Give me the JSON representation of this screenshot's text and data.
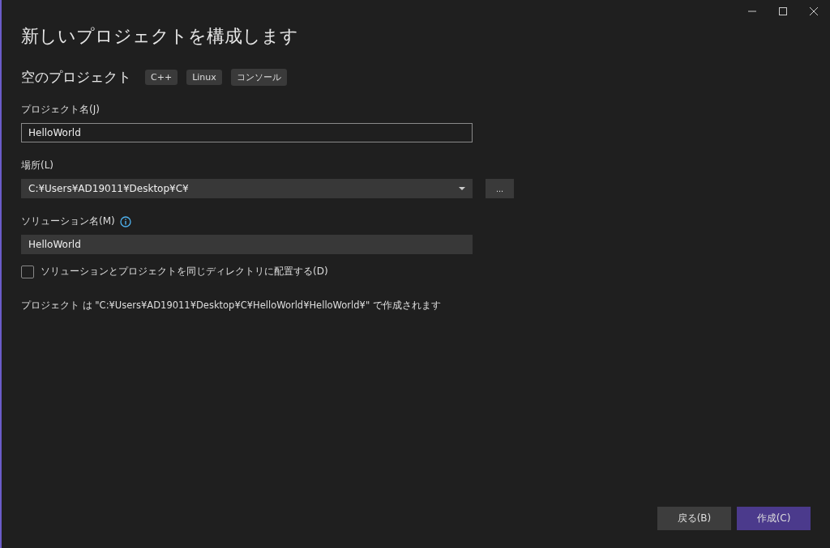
{
  "window": {
    "title": "新しいプロジェクトを構成します"
  },
  "template": {
    "name": "空のプロジェクト",
    "tags": [
      "C++",
      "Linux",
      "コンソール"
    ]
  },
  "project_name": {
    "label": "プロジェクト名(J)",
    "value": "HelloWorld",
    "focused": true
  },
  "location": {
    "label": "場所(L)",
    "value": "C:¥Users¥AD19011¥Desktop¥C¥",
    "browse_button": "..."
  },
  "solution_name": {
    "label": "ソリューション名(M)",
    "value": "HelloWorld"
  },
  "same_directory": {
    "label": "ソリューションとプロジェクトを同じディレクトリに配置する(D)",
    "checked": false
  },
  "summary": "プロジェクト は \"C:¥Users¥AD19011¥Desktop¥C¥HelloWorld¥HelloWorld¥\" で作成されます",
  "buttons": [
    {
      "label": "戻る(B)",
      "kind": "secondary"
    },
    {
      "label": "作成(C)",
      "kind": "primary"
    }
  ]
}
